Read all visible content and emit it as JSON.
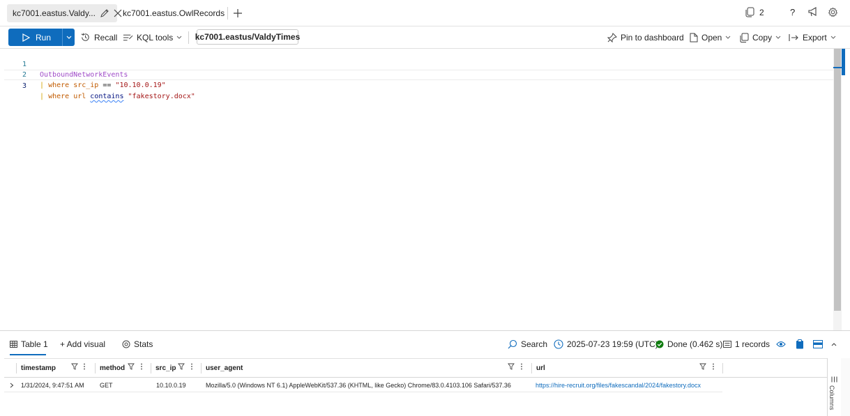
{
  "tabs": [
    {
      "label": "kc7001.eastus.Valdy..."
    },
    {
      "label": "kc7001.eastus.OwlRecords"
    }
  ],
  "topright": {
    "count_label": "2",
    "help_label": "?"
  },
  "toolbar": {
    "run_label": "Run",
    "recall_label": "Recall",
    "kql_tools_label": "KQL tools",
    "cluster_label": "kc7001.eastus/ValdyTimes",
    "pin_label": "Pin to dashboard",
    "open_label": "Open",
    "copy_label": "Copy",
    "export_label": "Export"
  },
  "editor": {
    "lines": [
      {
        "num": "1",
        "table": "OutboundNetworkEvents"
      },
      {
        "num": "2",
        "pipe": "|",
        "kw": "where",
        "field": "src_ip",
        "op": "==",
        "value": "\"10.10.0.19\""
      },
      {
        "num": "3",
        "pipe": "|",
        "kw": "where",
        "field": "url",
        "op": "contains",
        "value": "\"fakestory.docx\""
      }
    ]
  },
  "results": {
    "tab_table": "Table 1",
    "tab_add_visual": "+ Add visual",
    "tab_stats": "Stats",
    "search_label": "Search",
    "time_label": "2025-07-23 19:59 (UTC)",
    "status_label": "Done (0.462 s)",
    "records_label": "1 records",
    "columns_label": "Columns"
  },
  "colors": {
    "accent": "#0f6cbd",
    "done_green": "#107c10",
    "table_kw": "#9f4ac8",
    "operator": "#c15b00",
    "string": "#a31515"
  },
  "grid": {
    "columns": [
      "timestamp",
      "method",
      "src_ip",
      "user_agent",
      "url"
    ],
    "rows": [
      {
        "timestamp": "1/31/2024, 9:47:51 AM",
        "method": "GET",
        "src_ip": "10.10.0.19",
        "user_agent": "Mozilla/5.0 (Windows NT 6.1) AppleWebKit/537.36 (KHTML, like Gecko) Chrome/83.0.4103.106 Safari/537.36",
        "url": "https://hire-recruit.org/files/fakescandal/2024/fakestory.docx"
      }
    ]
  }
}
